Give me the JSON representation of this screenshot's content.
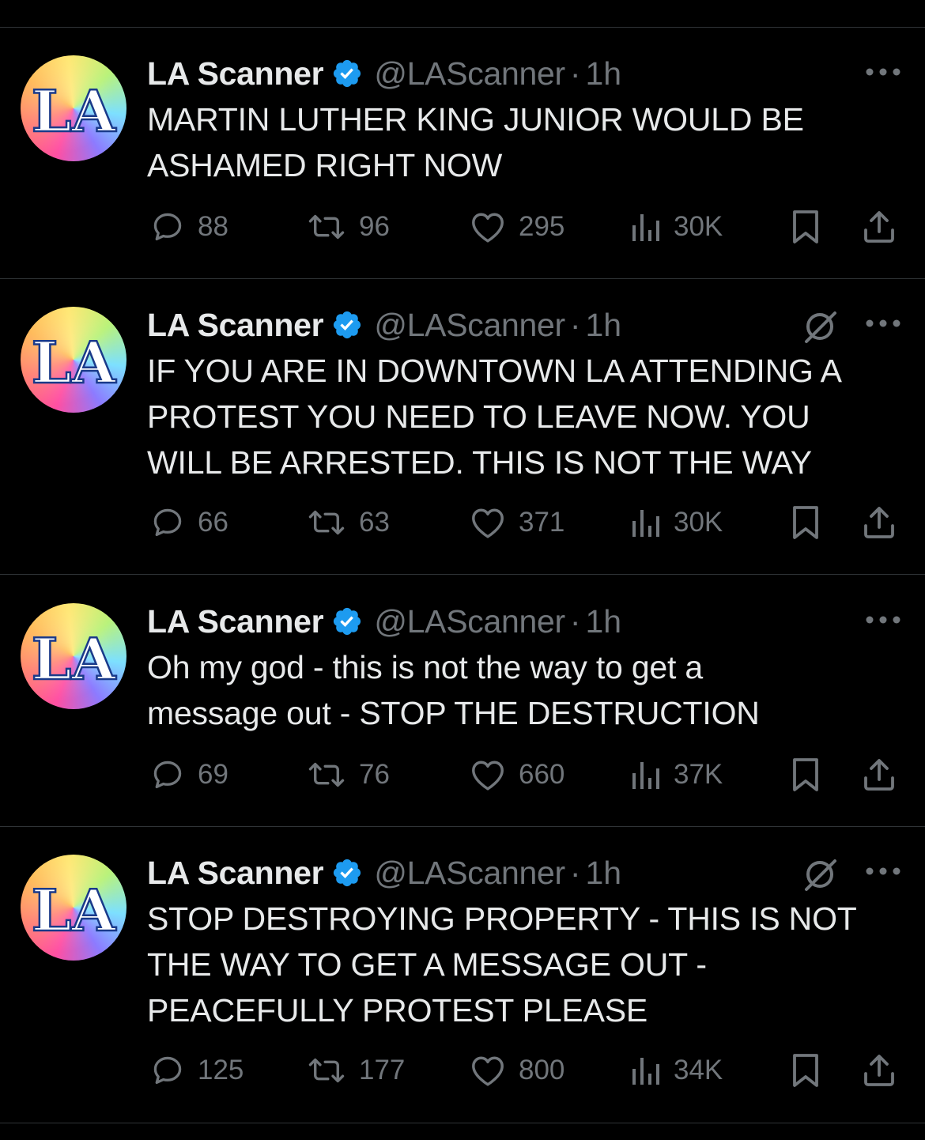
{
  "colors": {
    "background": "#000000",
    "text": "#e7e9ea",
    "muted": "#71767b",
    "divider": "#2f3336",
    "verified": "#1d9bf0"
  },
  "avatar_text": "LA",
  "icons": {
    "reply": "speech-bubble",
    "retweet": "two-arrows-loop",
    "like": "heart-outline",
    "views": "bar-chart",
    "bookmark": "bookmark-outline",
    "share": "upload-arrow",
    "more": "three-dots",
    "verified": "blue-check-badge",
    "grok": "slashed-circle"
  },
  "tweets": [
    {
      "name": "LA Scanner",
      "handle": "@LAScanner",
      "separator": "·",
      "time": "1h",
      "text": "MARTIN LUTHER KING JUNIOR WOULD BE\nASHAMED RIGHT NOW",
      "has_grok": false,
      "replies": "88",
      "retweets": "96",
      "likes": "295",
      "views": "30K"
    },
    {
      "name": "LA Scanner",
      "handle": "@LAScanner",
      "separator": "·",
      "time": "1h",
      "text": "IF YOU ARE IN DOWNTOWN LA ATTENDING A\nPROTEST YOU NEED TO LEAVE NOW. YOU\nWILL BE ARRESTED. THIS IS NOT THE WAY",
      "has_grok": true,
      "replies": "66",
      "retweets": "63",
      "likes": "371",
      "views": "30K"
    },
    {
      "name": "LA Scanner",
      "handle": "@LAScanner",
      "separator": "·",
      "time": "1h",
      "text": "Oh my god - this is not the way to get a\nmessage out - STOP THE DESTRUCTION",
      "has_grok": false,
      "replies": "69",
      "retweets": "76",
      "likes": "660",
      "views": "37K"
    },
    {
      "name": "LA Scanner",
      "handle": "@LAScanner",
      "separator": "·",
      "time": "1h",
      "text": "STOP DESTROYING PROPERTY - THIS IS NOT\nTHE WAY TO GET A MESSAGE OUT -\nPEACEFULLY PROTEST PLEASE",
      "has_grok": true,
      "replies": "125",
      "retweets": "177",
      "likes": "800",
      "views": "34K"
    }
  ]
}
